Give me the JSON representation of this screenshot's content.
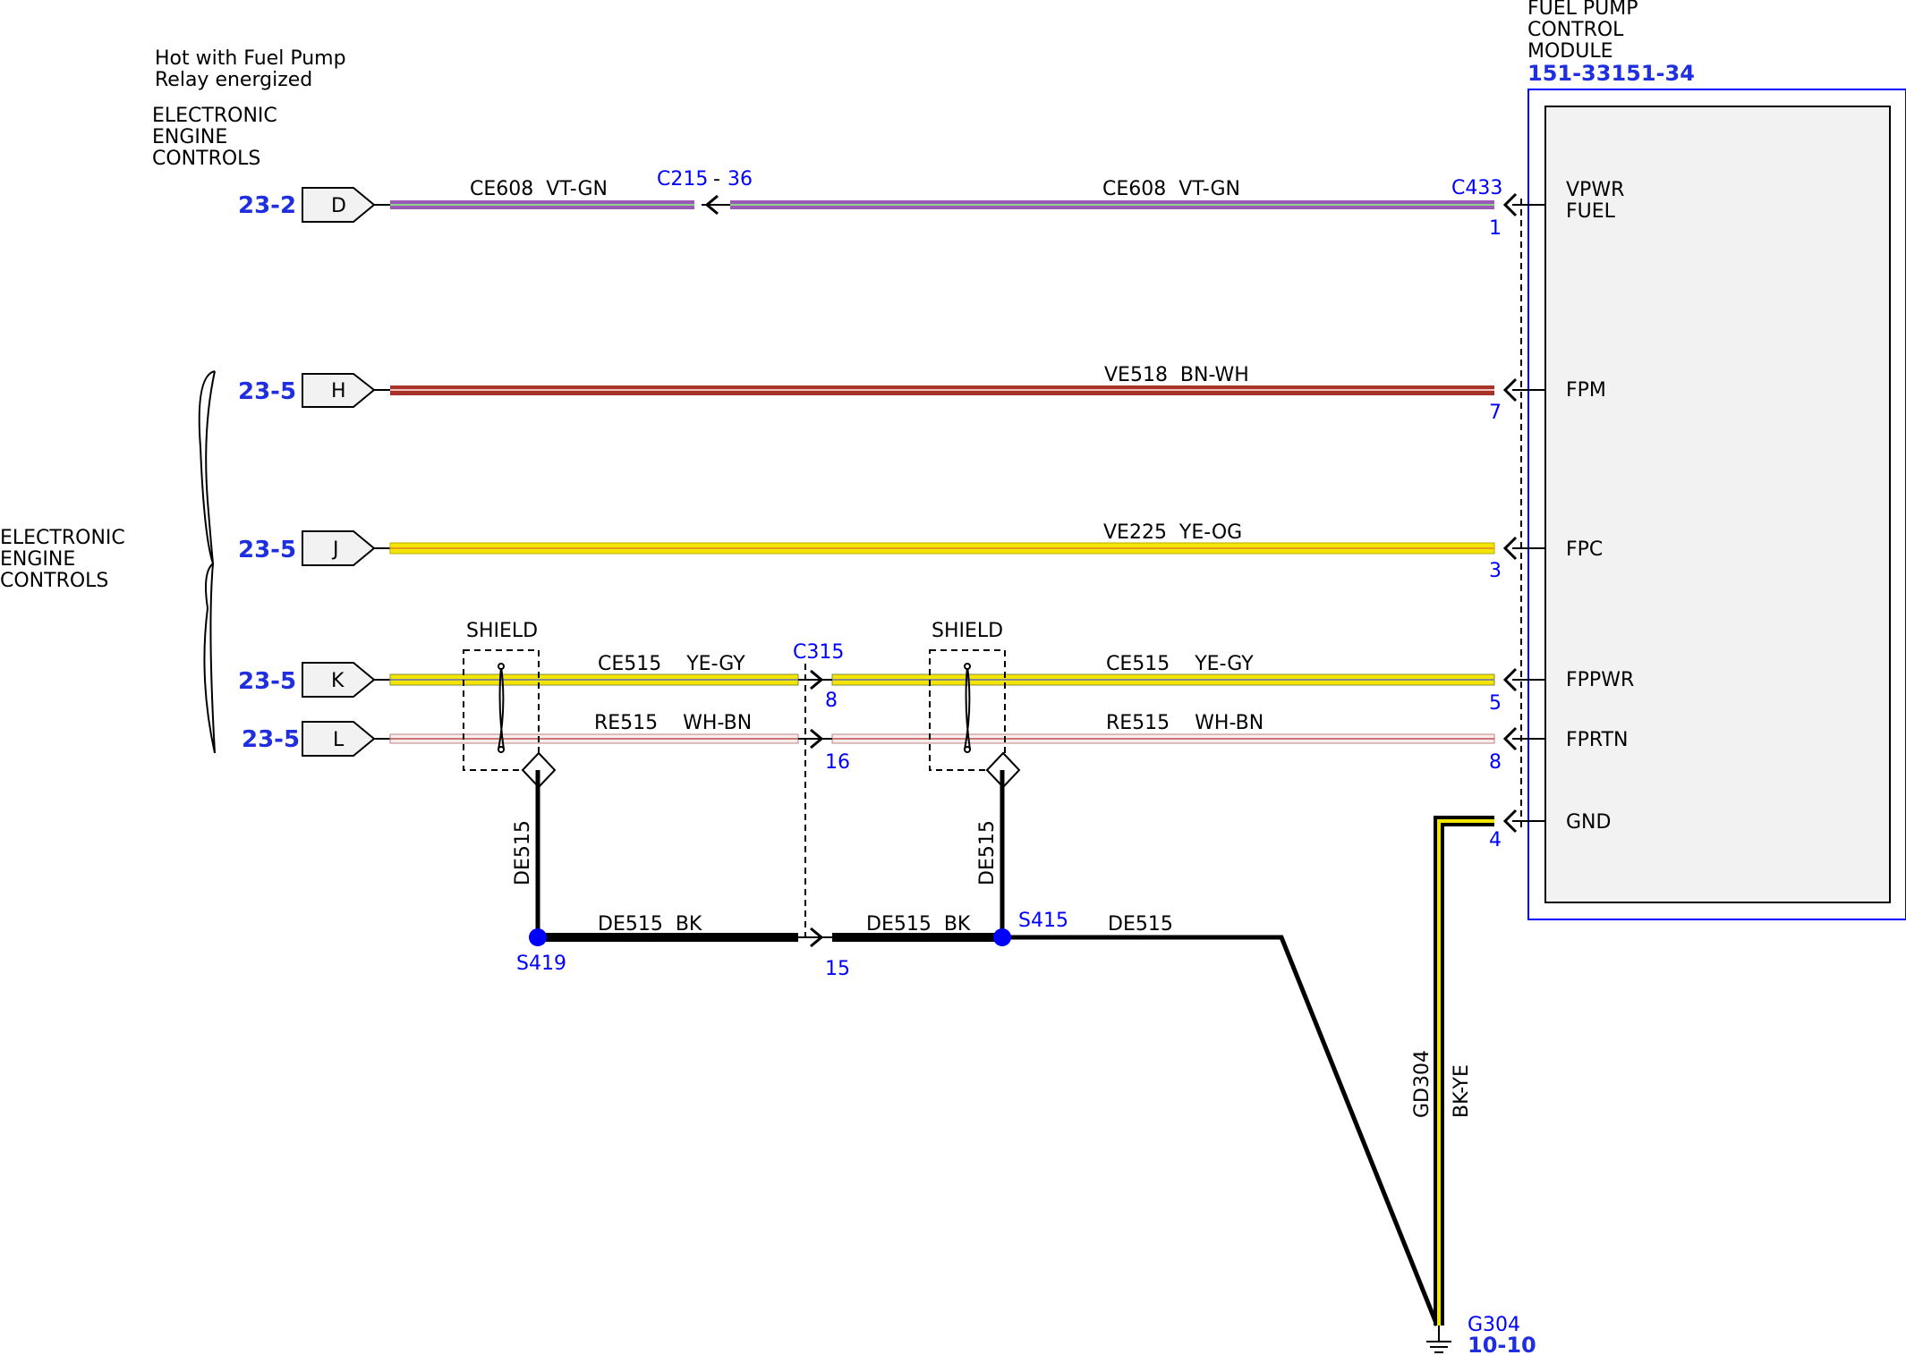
{
  "colors": {
    "link_blue": "#0000ff",
    "ref_blue": "#1f2fe0",
    "violet_green": [
      "#9b59b6",
      "#3f8f3f"
    ],
    "brown_white": "#a93226",
    "yellow_orange": "#f2e600",
    "yellow_gray": "#f2e600",
    "white_brown": "#d9a0a0",
    "black_yellow": "#000000"
  },
  "header": {
    "hot_line1": "Hot with Fuel Pump",
    "hot_line2": "Relay energized",
    "eec_top": [
      "ELECTRONIC",
      "ENGINE",
      "CONTROLS"
    ],
    "eec_left": [
      "ELECTRONIC",
      "ENGINE",
      "CONTROLS"
    ]
  },
  "module": {
    "name_lines": [
      "FUEL PUMP",
      "CONTROL",
      "MODULE"
    ],
    "part_number": "151-33151-34",
    "connector": "C433"
  },
  "refs": {
    "d": "23-2",
    "h": "23-5",
    "j": "23-5",
    "k": "23-5",
    "l": "23-5"
  },
  "connectors_left": {
    "d": "D",
    "h": "H",
    "j": "J",
    "k": "K",
    "l": "L"
  },
  "circuits": {
    "ce608_left": "CE608  VT-GN",
    "ce608_right": "CE608  VT-GN",
    "ve518": "VE518  BN-WH",
    "ve225": "VE225  YE-OG",
    "ce515_left": "CE515    YE-GY",
    "ce515_right": "CE515    YE-GY",
    "re515_left": "RE515    WH-BN",
    "re515_right": "RE515    WH-BN",
    "de515_bk_left": "DE515  BK",
    "de515_bk_right": "DE515  BK",
    "de515_right": "DE515",
    "de515_vert_left": "DE515",
    "de515_vert_right": "DE515",
    "gd304": "GD304",
    "gd304_color": "BK-YE"
  },
  "inline_connectors": {
    "c215": "C215",
    "c215_dash": "-",
    "c215_pin": "36",
    "c315": "C315",
    "c315_pin_k": "8",
    "c315_pin_l": "16",
    "c315_pin_ground": "15"
  },
  "module_pins": [
    {
      "num": "1",
      "name_lines": [
        "VPWR",
        "FUEL"
      ]
    },
    {
      "num": "7",
      "name_lines": [
        "FPM"
      ]
    },
    {
      "num": "3",
      "name_lines": [
        "FPC"
      ]
    },
    {
      "num": "5",
      "name_lines": [
        "FPPWR"
      ]
    },
    {
      "num": "8",
      "name_lines": [
        "FPRTN"
      ]
    },
    {
      "num": "4",
      "name_lines": [
        "GND"
      ]
    }
  ],
  "shields": {
    "left": "SHIELD",
    "right": "SHIELD"
  },
  "splices": {
    "s419": "S419",
    "s415": "S415"
  },
  "ground": {
    "name": "G304",
    "ref": "10-10"
  }
}
